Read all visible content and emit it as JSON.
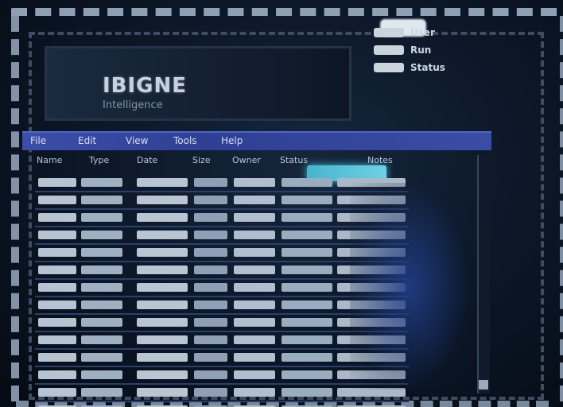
{
  "logo": {
    "title": "IBIGNE",
    "subtitle": "Intelligence"
  },
  "info": [
    {
      "label": "User"
    },
    {
      "label": "Run"
    },
    {
      "label": "Status"
    }
  ],
  "menu": [
    "File",
    "Edit",
    "View",
    "Tools",
    "Help"
  ],
  "table": {
    "columns": [
      "Name",
      "Type",
      "Date",
      "Size",
      "Owner",
      "Status",
      "Notes"
    ],
    "rows": 14
  }
}
